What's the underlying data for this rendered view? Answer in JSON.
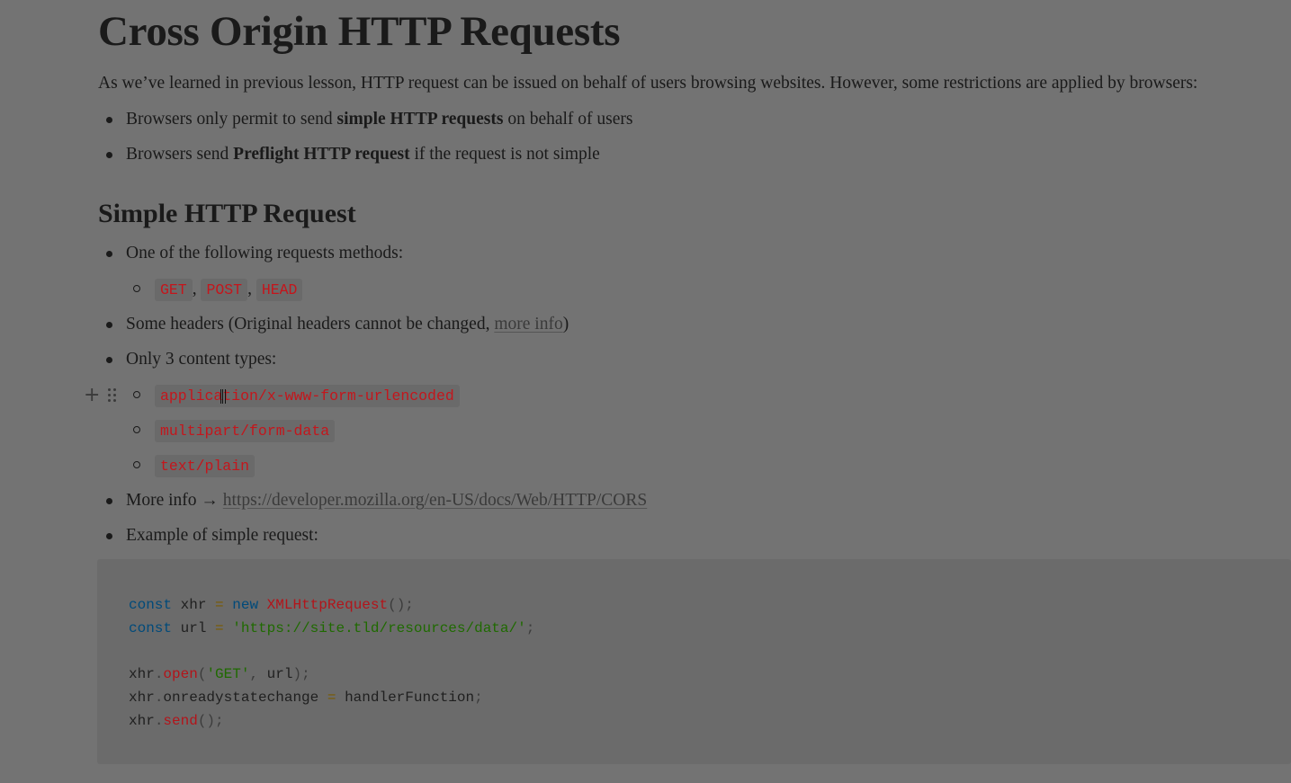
{
  "page": {
    "title": "Cross Origin HTTP Requests",
    "intro": "As we’ve learned in previous lesson, HTTP request can be issued on behalf of users browsing websites. However, some restrictions are applied by browsers:",
    "intro_bullets": [
      {
        "pre": "Browsers only permit to send ",
        "bold": "simple HTTP requests",
        "post": " on behalf of users"
      },
      {
        "pre": "Browsers send ",
        "bold": "Preflight HTTP request",
        "post": " if the request is not simple"
      }
    ],
    "section_heading": "Simple HTTP Request",
    "methods_label": "One of the following requests methods:",
    "methods": [
      "GET",
      "POST",
      "HEAD"
    ],
    "method_separator": ",",
    "headers_text": "Some headers (Original headers cannot be changed, ",
    "headers_link": "more info",
    "headers_close": ")",
    "content_types_label": "Only 3 content types:",
    "content_types": [
      "application/x-www-form-urlencoded",
      "multipart/form-data",
      "text/plain"
    ],
    "more_info_label": "More info → ",
    "more_info_url": "https://developer.mozilla.org/en-US/docs/Web/HTTP/CORS",
    "example_label": "Example of simple request:"
  },
  "code_block": {
    "language": "javascript",
    "lines": [
      "const xhr = new XMLHttpRequest();",
      "const url = 'https://site.tld/resources/data/';",
      "",
      "xhr.open('GET', url);",
      "xhr.onreadystatechange = handlerFunction;",
      "xhr.send();"
    ]
  },
  "icons": {
    "add_block": "plus-icon",
    "drag_handle": "drag-handle-icon"
  },
  "colors": {
    "background": "#737373",
    "inline_code": "#c4161c",
    "keyword": "#004a7a",
    "string": "#1f6a00"
  }
}
